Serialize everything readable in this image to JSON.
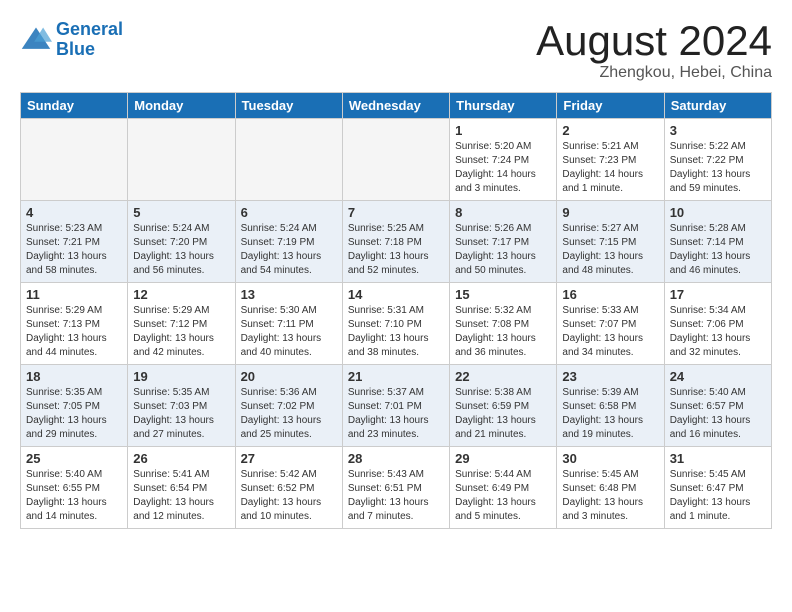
{
  "header": {
    "logo_line1": "General",
    "logo_line2": "Blue",
    "month_year": "August 2024",
    "location": "Zhengkou, Hebei, China"
  },
  "weekdays": [
    "Sunday",
    "Monday",
    "Tuesday",
    "Wednesday",
    "Thursday",
    "Friday",
    "Saturday"
  ],
  "weeks": [
    [
      {
        "day": "",
        "info": ""
      },
      {
        "day": "",
        "info": ""
      },
      {
        "day": "",
        "info": ""
      },
      {
        "day": "",
        "info": ""
      },
      {
        "day": "1",
        "info": "Sunrise: 5:20 AM\nSunset: 7:24 PM\nDaylight: 14 hours\nand 3 minutes."
      },
      {
        "day": "2",
        "info": "Sunrise: 5:21 AM\nSunset: 7:23 PM\nDaylight: 14 hours\nand 1 minute."
      },
      {
        "day": "3",
        "info": "Sunrise: 5:22 AM\nSunset: 7:22 PM\nDaylight: 13 hours\nand 59 minutes."
      }
    ],
    [
      {
        "day": "4",
        "info": "Sunrise: 5:23 AM\nSunset: 7:21 PM\nDaylight: 13 hours\nand 58 minutes."
      },
      {
        "day": "5",
        "info": "Sunrise: 5:24 AM\nSunset: 7:20 PM\nDaylight: 13 hours\nand 56 minutes."
      },
      {
        "day": "6",
        "info": "Sunrise: 5:24 AM\nSunset: 7:19 PM\nDaylight: 13 hours\nand 54 minutes."
      },
      {
        "day": "7",
        "info": "Sunrise: 5:25 AM\nSunset: 7:18 PM\nDaylight: 13 hours\nand 52 minutes."
      },
      {
        "day": "8",
        "info": "Sunrise: 5:26 AM\nSunset: 7:17 PM\nDaylight: 13 hours\nand 50 minutes."
      },
      {
        "day": "9",
        "info": "Sunrise: 5:27 AM\nSunset: 7:15 PM\nDaylight: 13 hours\nand 48 minutes."
      },
      {
        "day": "10",
        "info": "Sunrise: 5:28 AM\nSunset: 7:14 PM\nDaylight: 13 hours\nand 46 minutes."
      }
    ],
    [
      {
        "day": "11",
        "info": "Sunrise: 5:29 AM\nSunset: 7:13 PM\nDaylight: 13 hours\nand 44 minutes."
      },
      {
        "day": "12",
        "info": "Sunrise: 5:29 AM\nSunset: 7:12 PM\nDaylight: 13 hours\nand 42 minutes."
      },
      {
        "day": "13",
        "info": "Sunrise: 5:30 AM\nSunset: 7:11 PM\nDaylight: 13 hours\nand 40 minutes."
      },
      {
        "day": "14",
        "info": "Sunrise: 5:31 AM\nSunset: 7:10 PM\nDaylight: 13 hours\nand 38 minutes."
      },
      {
        "day": "15",
        "info": "Sunrise: 5:32 AM\nSunset: 7:08 PM\nDaylight: 13 hours\nand 36 minutes."
      },
      {
        "day": "16",
        "info": "Sunrise: 5:33 AM\nSunset: 7:07 PM\nDaylight: 13 hours\nand 34 minutes."
      },
      {
        "day": "17",
        "info": "Sunrise: 5:34 AM\nSunset: 7:06 PM\nDaylight: 13 hours\nand 32 minutes."
      }
    ],
    [
      {
        "day": "18",
        "info": "Sunrise: 5:35 AM\nSunset: 7:05 PM\nDaylight: 13 hours\nand 29 minutes."
      },
      {
        "day": "19",
        "info": "Sunrise: 5:35 AM\nSunset: 7:03 PM\nDaylight: 13 hours\nand 27 minutes."
      },
      {
        "day": "20",
        "info": "Sunrise: 5:36 AM\nSunset: 7:02 PM\nDaylight: 13 hours\nand 25 minutes."
      },
      {
        "day": "21",
        "info": "Sunrise: 5:37 AM\nSunset: 7:01 PM\nDaylight: 13 hours\nand 23 minutes."
      },
      {
        "day": "22",
        "info": "Sunrise: 5:38 AM\nSunset: 6:59 PM\nDaylight: 13 hours\nand 21 minutes."
      },
      {
        "day": "23",
        "info": "Sunrise: 5:39 AM\nSunset: 6:58 PM\nDaylight: 13 hours\nand 19 minutes."
      },
      {
        "day": "24",
        "info": "Sunrise: 5:40 AM\nSunset: 6:57 PM\nDaylight: 13 hours\nand 16 minutes."
      }
    ],
    [
      {
        "day": "25",
        "info": "Sunrise: 5:40 AM\nSunset: 6:55 PM\nDaylight: 13 hours\nand 14 minutes."
      },
      {
        "day": "26",
        "info": "Sunrise: 5:41 AM\nSunset: 6:54 PM\nDaylight: 13 hours\nand 12 minutes."
      },
      {
        "day": "27",
        "info": "Sunrise: 5:42 AM\nSunset: 6:52 PM\nDaylight: 13 hours\nand 10 minutes."
      },
      {
        "day": "28",
        "info": "Sunrise: 5:43 AM\nSunset: 6:51 PM\nDaylight: 13 hours\nand 7 minutes."
      },
      {
        "day": "29",
        "info": "Sunrise: 5:44 AM\nSunset: 6:49 PM\nDaylight: 13 hours\nand 5 minutes."
      },
      {
        "day": "30",
        "info": "Sunrise: 5:45 AM\nSunset: 6:48 PM\nDaylight: 13 hours\nand 3 minutes."
      },
      {
        "day": "31",
        "info": "Sunrise: 5:45 AM\nSunset: 6:47 PM\nDaylight: 13 hours\nand 1 minute."
      }
    ]
  ]
}
